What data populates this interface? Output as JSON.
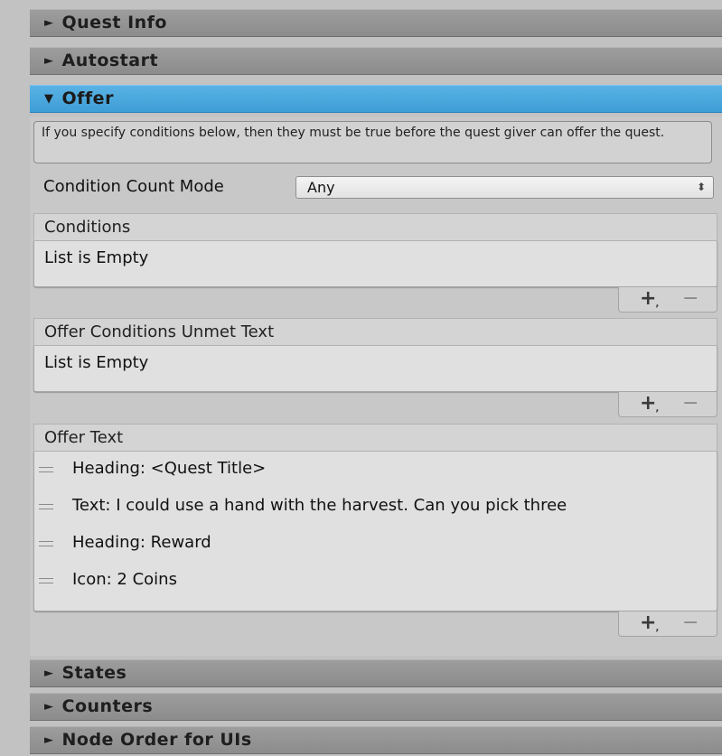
{
  "sections": {
    "quest_info": "Quest Info",
    "autostart": "Autostart",
    "offer": "Offer",
    "states": "States",
    "counters": "Counters",
    "node_order": "Node Order for UIs"
  },
  "arrows": {
    "collapsed": "►",
    "expanded": "▼"
  },
  "offer": {
    "help_text": "If you specify conditions below, then they must be true before the quest giver can offer the quest.",
    "condition_count_mode_label": "Condition Count Mode",
    "condition_count_mode_value": "Any",
    "conditions": {
      "header": "Conditions",
      "empty_text": "List is Empty"
    },
    "unmet_text": {
      "header": "Offer Conditions Unmet Text",
      "empty_text": "List is Empty"
    },
    "offer_text": {
      "header": "Offer Text",
      "items": [
        "Heading: <Quest Title>",
        "Text: I could use a hand with the harvest. Can you pick three",
        "Heading: Reward",
        "Icon: 2 Coins"
      ]
    }
  },
  "list_footer": {
    "add": "+",
    "add_dot": ",",
    "remove": "−"
  },
  "colors": {
    "accent": "#48a8de",
    "foldout": "#959595"
  }
}
